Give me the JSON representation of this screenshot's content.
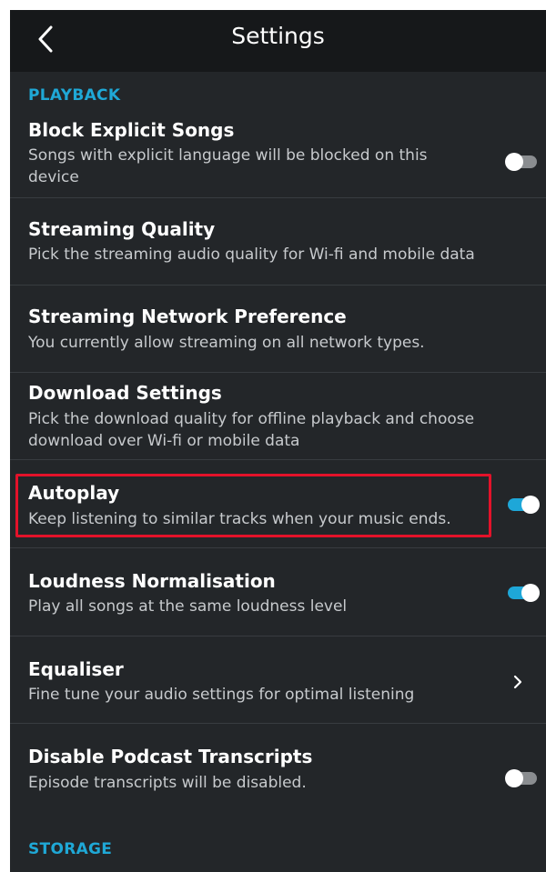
{
  "header": {
    "title": "Settings",
    "back_icon": "chevron-left-icon"
  },
  "sections": {
    "playback": "PLAYBACK",
    "storage": "STORAGE"
  },
  "rows": [
    {
      "title": "Block Explicit Songs",
      "desc": "Songs with explicit language will be blocked on this device",
      "control": "toggle",
      "on": false
    },
    {
      "title": "Streaming Quality",
      "desc": "Pick the streaming audio quality for Wi-fi and mobile data",
      "control": "none"
    },
    {
      "title": "Streaming Network Preference",
      "desc": "You currently allow streaming on all network types.",
      "control": "none"
    },
    {
      "title": "Download Settings",
      "desc": "Pick the download quality for offline playback and choose download over Wi-fi or mobile data",
      "control": "none"
    },
    {
      "title": "Autoplay",
      "desc": "Keep listening to similar tracks when your music ends.",
      "control": "toggle",
      "on": true,
      "highlighted": true
    },
    {
      "title": "Loudness Normalisation",
      "desc": "Play all songs at the same loudness level",
      "control": "toggle",
      "on": true
    },
    {
      "title": "Equaliser",
      "desc": "Fine tune your audio settings for optimal listening",
      "control": "chevron"
    },
    {
      "title": "Disable Podcast Transcripts",
      "desc": "Episode transcripts will be disabled.",
      "control": "toggle",
      "on": false
    }
  ],
  "colors": {
    "accent": "#1ea7d8",
    "background": "#232629",
    "header_background": "#16181a",
    "highlight_border": "#e3122a"
  }
}
